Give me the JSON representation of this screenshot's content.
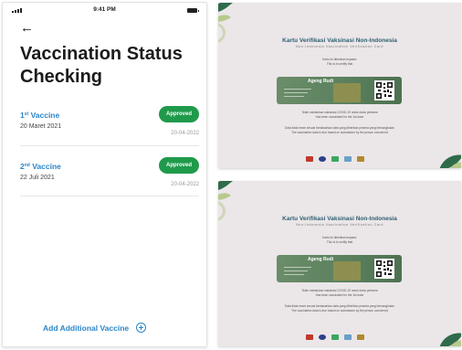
{
  "phone": {
    "time": "9:41 PM",
    "title": "Vaccination Status Checking",
    "vaccines": [
      {
        "ordinal_num": "1",
        "ordinal_suffix": "st",
        "name": "Vaccine",
        "date": "20 Maret 2021",
        "status": "Approved",
        "status_date": "20-04-2022"
      },
      {
        "ordinal_num": "2",
        "ordinal_suffix": "nd",
        "name": "Vaccine",
        "date": "22 Juli 2021",
        "status": "Approved",
        "status_date": "20-04-2022"
      }
    ],
    "add_label": "Add Additional Vaccine"
  },
  "certificates": [
    {
      "title": "Kartu Verifikasi Vaksinasi Non-Indonesia",
      "subtitle": "Non-Indonesia Vaccination Verification Card",
      "given_to_line1": "Kartu ini diberikan kepada:",
      "given_to_line2": "This is to certify that",
      "holder_name": "Ageng Rudi",
      "message_line1": "Telah melakukan vaksinasi COVID-19 untuk dosis pertama",
      "message_line2": "Has been vaccinated for the 1st dose",
      "footer_line1": "Data tidak resmi sesuai berdasarkan data yang diberikan peserta yang bersangkutan",
      "footer_line2": "The vaccination data is true based on submission by the person concerned"
    },
    {
      "title": "Kartu Verifikasi Vaksinasi Non-Indonesia",
      "subtitle": "Non-Indonesia Vaccination Verification Card",
      "given_to_line1": "Kartu ini diberikan kepada:",
      "given_to_line2": "This is to certify that",
      "holder_name": "Ageng Rudi",
      "message_line1": "Telah melakukan vaksinasi COVID-19 untuk dosis pertama",
      "message_line2": "Has been vaccinated for the 1st dose",
      "footer_line1": "Data tidak resmi sesuai berdasarkan data yang diberikan peserta yang bersangkutan",
      "footer_line2": "The vaccination data is true based on submission by the person concerned"
    }
  ],
  "colors": {
    "accent_blue": "#2a86c9",
    "approved_green": "#1f9a4b",
    "card_green": "#5a7f5c",
    "cert_background": "#ebe6e8",
    "cert_title": "#2e5f70"
  },
  "icons": {
    "back": "arrow-left-icon",
    "add": "plus-circle-icon",
    "signal": "signal-icon",
    "battery": "battery-icon",
    "qr": "qr-code-icon"
  }
}
